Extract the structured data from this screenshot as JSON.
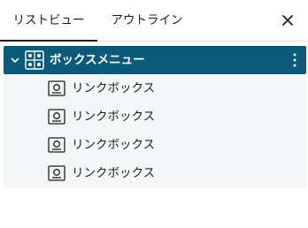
{
  "tabs": [
    {
      "label": "リストビュー",
      "active": true
    },
    {
      "label": "アウトライン",
      "active": false
    }
  ],
  "close_icon": "close-icon",
  "tree": {
    "parent": {
      "label": "ボックスメニュー",
      "icon": "box-menu-block-icon",
      "expanded": true
    },
    "children": [
      {
        "label": "リンクボックス",
        "icon": "link-box-block-icon"
      },
      {
        "label": "リンクボックス",
        "icon": "link-box-block-icon"
      },
      {
        "label": "リンクボックス",
        "icon": "link-box-block-icon"
      },
      {
        "label": "リンクボックス",
        "icon": "link-box-block-icon"
      }
    ]
  },
  "colors": {
    "selected_row_bg": "#0b5a7a",
    "children_bg": "#f3f7f8",
    "text": "#1e1e1e"
  }
}
